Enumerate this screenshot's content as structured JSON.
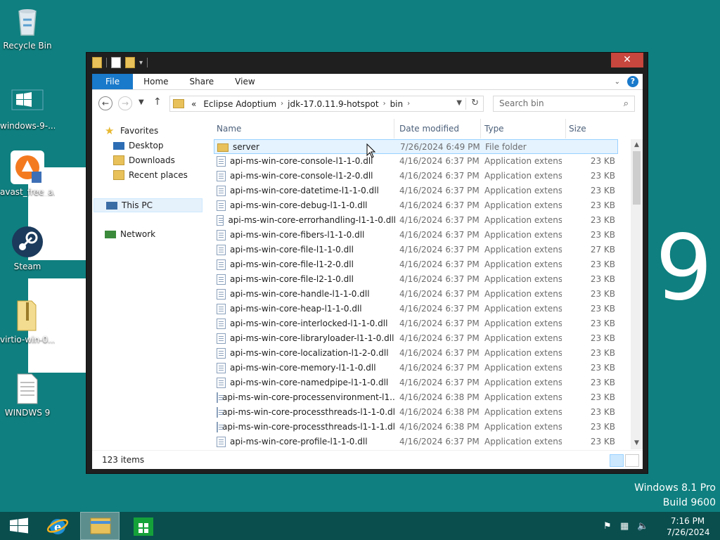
{
  "desktop": {
    "icons": [
      {
        "label": "Recycle Bin",
        "icon": "recycle-bin-icon"
      },
      {
        "label": "windows-9-...",
        "icon": "windows-logo-icon"
      },
      {
        "label": "avast_free_a...",
        "icon": "avast-icon"
      },
      {
        "label": "Steam",
        "icon": "steam-icon"
      },
      {
        "label": "virtio-win-0....",
        "icon": "zip-folder-icon"
      },
      {
        "label": "WINDWS 9",
        "icon": "text-document-icon"
      }
    ],
    "big_number": "9",
    "edition_line1": "Windows 8.1 Pro",
    "edition_line2": "Build 9600",
    "background_color": "#0f7f7f"
  },
  "window": {
    "close_label": "✕",
    "ribbon_tabs": [
      "File",
      "Home",
      "Share",
      "View"
    ],
    "help_label": "?",
    "address": {
      "prefix": "«",
      "crumbs": [
        "Eclipse Adoptium",
        "jdk-17.0.11.9-hotspot",
        "bin"
      ]
    },
    "search_placeholder": "Search bin",
    "nav": {
      "favorites": "Favorites",
      "desktop": "Desktop",
      "downloads": "Downloads",
      "recent": "Recent places",
      "this_pc": "This PC",
      "network": "Network"
    },
    "columns": {
      "name": "Name",
      "date": "Date modified",
      "type": "Type",
      "size": "Size"
    },
    "files": [
      {
        "name": "server",
        "date": "7/26/2024 6:49 PM",
        "type": "File folder",
        "size": "",
        "kind": "folder"
      },
      {
        "name": "api-ms-win-core-console-l1-1-0.dll",
        "date": "4/16/2024 6:37 PM",
        "type": "Application extens...",
        "size": "23 KB",
        "kind": "dll"
      },
      {
        "name": "api-ms-win-core-console-l1-2-0.dll",
        "date": "4/16/2024 6:37 PM",
        "type": "Application extens...",
        "size": "23 KB",
        "kind": "dll"
      },
      {
        "name": "api-ms-win-core-datetime-l1-1-0.dll",
        "date": "4/16/2024 6:37 PM",
        "type": "Application extens...",
        "size": "23 KB",
        "kind": "dll"
      },
      {
        "name": "api-ms-win-core-debug-l1-1-0.dll",
        "date": "4/16/2024 6:37 PM",
        "type": "Application extens...",
        "size": "23 KB",
        "kind": "dll"
      },
      {
        "name": "api-ms-win-core-errorhandling-l1-1-0.dll",
        "date": "4/16/2024 6:37 PM",
        "type": "Application extens...",
        "size": "23 KB",
        "kind": "dll"
      },
      {
        "name": "api-ms-win-core-fibers-l1-1-0.dll",
        "date": "4/16/2024 6:37 PM",
        "type": "Application extens...",
        "size": "23 KB",
        "kind": "dll"
      },
      {
        "name": "api-ms-win-core-file-l1-1-0.dll",
        "date": "4/16/2024 6:37 PM",
        "type": "Application extens...",
        "size": "27 KB",
        "kind": "dll"
      },
      {
        "name": "api-ms-win-core-file-l1-2-0.dll",
        "date": "4/16/2024 6:37 PM",
        "type": "Application extens...",
        "size": "23 KB",
        "kind": "dll"
      },
      {
        "name": "api-ms-win-core-file-l2-1-0.dll",
        "date": "4/16/2024 6:37 PM",
        "type": "Application extens...",
        "size": "23 KB",
        "kind": "dll"
      },
      {
        "name": "api-ms-win-core-handle-l1-1-0.dll",
        "date": "4/16/2024 6:37 PM",
        "type": "Application extens...",
        "size": "23 KB",
        "kind": "dll"
      },
      {
        "name": "api-ms-win-core-heap-l1-1-0.dll",
        "date": "4/16/2024 6:37 PM",
        "type": "Application extens...",
        "size": "23 KB",
        "kind": "dll"
      },
      {
        "name": "api-ms-win-core-interlocked-l1-1-0.dll",
        "date": "4/16/2024 6:37 PM",
        "type": "Application extens...",
        "size": "23 KB",
        "kind": "dll"
      },
      {
        "name": "api-ms-win-core-libraryloader-l1-1-0.dll",
        "date": "4/16/2024 6:37 PM",
        "type": "Application extens...",
        "size": "23 KB",
        "kind": "dll"
      },
      {
        "name": "api-ms-win-core-localization-l1-2-0.dll",
        "date": "4/16/2024 6:37 PM",
        "type": "Application extens...",
        "size": "23 KB",
        "kind": "dll"
      },
      {
        "name": "api-ms-win-core-memory-l1-1-0.dll",
        "date": "4/16/2024 6:37 PM",
        "type": "Application extens...",
        "size": "23 KB",
        "kind": "dll"
      },
      {
        "name": "api-ms-win-core-namedpipe-l1-1-0.dll",
        "date": "4/16/2024 6:37 PM",
        "type": "Application extens...",
        "size": "23 KB",
        "kind": "dll"
      },
      {
        "name": "api-ms-win-core-processenvironment-l1...",
        "date": "4/16/2024 6:38 PM",
        "type": "Application extens...",
        "size": "23 KB",
        "kind": "dll"
      },
      {
        "name": "api-ms-win-core-processthreads-l1-1-0.dll",
        "date": "4/16/2024 6:38 PM",
        "type": "Application extens...",
        "size": "23 KB",
        "kind": "dll"
      },
      {
        "name": "api-ms-win-core-processthreads-l1-1-1.dll",
        "date": "4/16/2024 6:38 PM",
        "type": "Application extens...",
        "size": "23 KB",
        "kind": "dll"
      },
      {
        "name": "api-ms-win-core-profile-l1-1-0.dll",
        "date": "4/16/2024 6:37 PM",
        "type": "Application extens...",
        "size": "23 KB",
        "kind": "dll"
      }
    ],
    "status_count": "123 items"
  },
  "taskbar": {
    "time": "7:16 PM",
    "date": "7/26/2024"
  },
  "colors": {
    "accent": "#1979ca",
    "close": "#c7463d",
    "selection": "#e5f3ff"
  }
}
